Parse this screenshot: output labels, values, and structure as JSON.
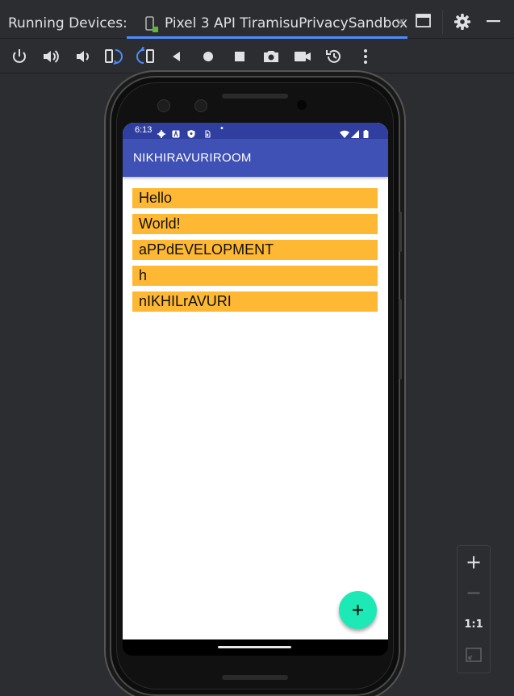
{
  "panel": {
    "title": "Running Devices:"
  },
  "device_tab": {
    "label": "Pixel 3 API TiramisuPrivacySandbox",
    "close": "×"
  },
  "toolbar": {
    "buttons": [
      "power-icon",
      "volume-up-icon",
      "volume-down-icon",
      "rotate-left-icon",
      "rotate-right-icon",
      "back-icon",
      "home-icon",
      "overview-icon",
      "screenshot-icon",
      "screen-record-icon",
      "snapshot-icon",
      "more-icon"
    ]
  },
  "status_bar": {
    "time": "6:13",
    "dot": "•"
  },
  "app_bar": {
    "title": "NIKHIRAVURIROOM"
  },
  "list": {
    "items": [
      {
        "text": "Hello"
      },
      {
        "text": "World!"
      },
      {
        "text": "aPPdEVELOPMENT"
      },
      {
        "text": "h"
      },
      {
        "text": "nIKHILrAVURI"
      }
    ]
  },
  "fab": {
    "icon": "plus-icon"
  },
  "zoom_controls": {
    "zoom_in": "+",
    "zoom_out": "−",
    "actual_size": "1:1"
  },
  "colors": {
    "app_bar": "#3f51b5",
    "status_bar": "#303f9f",
    "list_item_bg": "#ffb833",
    "fab": "#1de9b6",
    "ide_bg": "#2b2d30",
    "tab_underline": "#4e8bff"
  }
}
